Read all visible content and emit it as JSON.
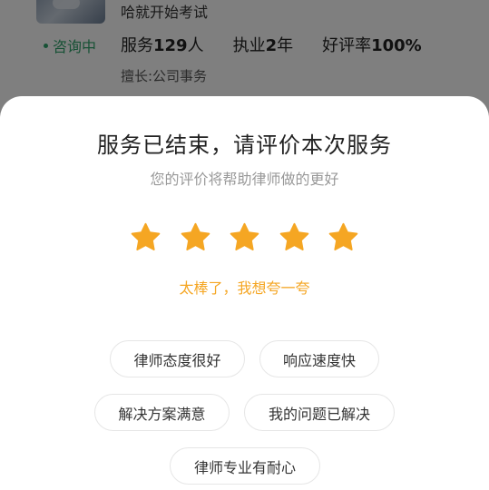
{
  "lawyer_card": {
    "intro_text": "哈就开始考试",
    "status": "咨询中",
    "stats": {
      "service_label": "服务",
      "service_value": "129",
      "service_unit": "人",
      "practice_label": "执业",
      "practice_value": "2",
      "practice_unit": "年",
      "rating_label": "好评率",
      "rating_value": "100%"
    },
    "expertise": "擅长:公司事务"
  },
  "review_sheet": {
    "title": "服务已结束，请评价本次服务",
    "subtitle": "您的评价将帮助律师做的更好",
    "rating": {
      "value": 5,
      "max": 5,
      "text": "太棒了，我想夸一夸"
    },
    "tags": [
      {
        "label": "律师态度很好"
      },
      {
        "label": "响应速度快"
      },
      {
        "label": "解决方案满意"
      },
      {
        "label": "我的问题已解决"
      },
      {
        "label": "律师专业有耐心"
      }
    ]
  },
  "colors": {
    "star": "#f5a623",
    "rating_text": "#f5a623",
    "status": "#2fa36b",
    "overlay": "rgba(0,0,0,0.5)"
  }
}
